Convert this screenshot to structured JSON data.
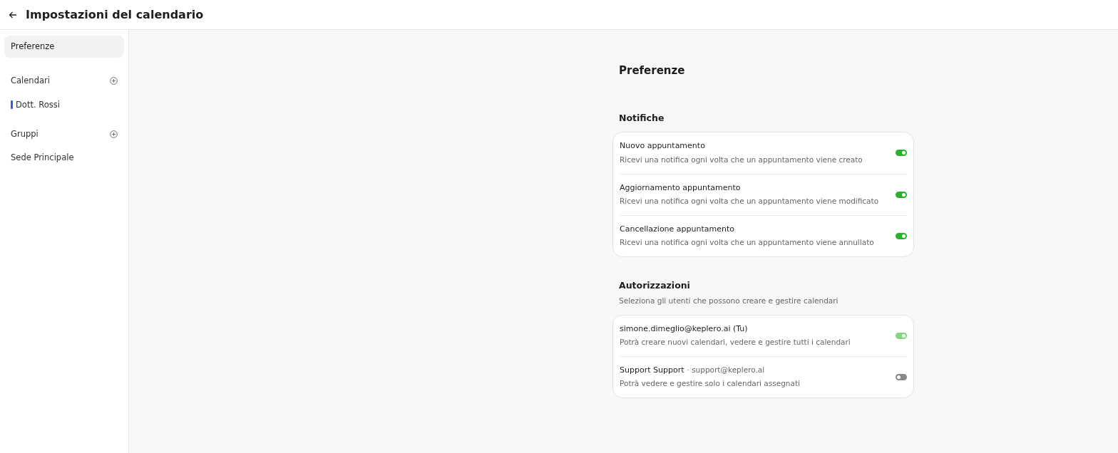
{
  "header": {
    "title": "Impostazioni del calendario"
  },
  "sidebar": {
    "items": [
      {
        "label": "Preferenze",
        "selected": true
      }
    ],
    "sections": [
      {
        "label": "Calendari",
        "items": [
          {
            "label": "Dott. Rossi",
            "color": "#3b5bdb"
          }
        ]
      },
      {
        "label": "Gruppi",
        "items": [
          {
            "label": "Sede Principale"
          }
        ]
      }
    ]
  },
  "page_title": "Preferenze",
  "notifications": {
    "title": "Notifiche",
    "items": [
      {
        "title": "Nuovo appuntamento",
        "description": "Ricevi una notifica ogni volta che un appuntamento viene creato",
        "on": true
      },
      {
        "title": "Aggiornamento appuntamento",
        "description": "Ricevi una notifica ogni volta che un appuntamento viene modificato",
        "on": true
      },
      {
        "title": "Cancellazione appuntamento",
        "description": "Ricevi una notifica ogni volta che un appuntamento viene annullato",
        "on": true
      }
    ]
  },
  "permissions": {
    "title": "Autorizzazioni",
    "subtitle": "Seleziona gli utenti che possono creare e gestire calendari",
    "items": [
      {
        "name": "simone.dimeglio@keplero.ai (Tu)",
        "description": "Potrà creare nuovi calendari, vedere e gestire tutti i calendari",
        "on": true,
        "disabled": true
      },
      {
        "name": "Support Support",
        "email": "· support@keplero.ai",
        "description": "Potrà vedere e gestire solo i calendari assegnati",
        "on": false,
        "disabled": false
      }
    ]
  }
}
